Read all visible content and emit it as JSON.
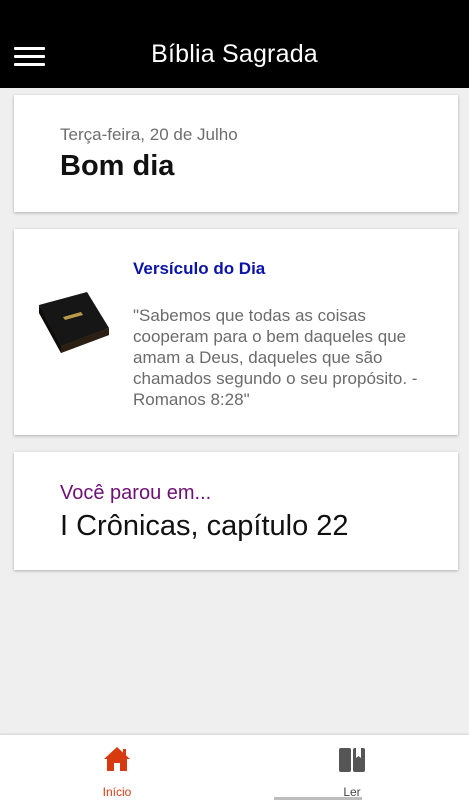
{
  "app_bar": {
    "title": "Bíblia Sagrada",
    "menu_icon": "hamburger-menu-icon"
  },
  "greeting_card": {
    "date": "Terça-feira, 20 de Julho",
    "greeting": "Bom dia"
  },
  "verse_card": {
    "image": "holy-bible-book-icon",
    "title": "Versículo do Dia",
    "text": "\"Sabemos que todas as coisas cooperam para o bem daqueles que amam a Deus, daqueles que são chamados segundo o seu propósito. - Romanos 8:28\""
  },
  "continue_card": {
    "label": "Você parou em...",
    "chapter": "I Crônicas, capítulo 22"
  },
  "bottom_nav": {
    "items": [
      {
        "label": "Início",
        "icon": "home-icon",
        "active": true
      },
      {
        "label": "Ler",
        "icon": "book-icon",
        "active": false
      }
    ]
  },
  "colors": {
    "app_bar": "#000000",
    "background": "#efefef",
    "verse_title": "#0b14a8",
    "continue_label": "#6d0f76",
    "active_nav": "#d83a0f"
  }
}
